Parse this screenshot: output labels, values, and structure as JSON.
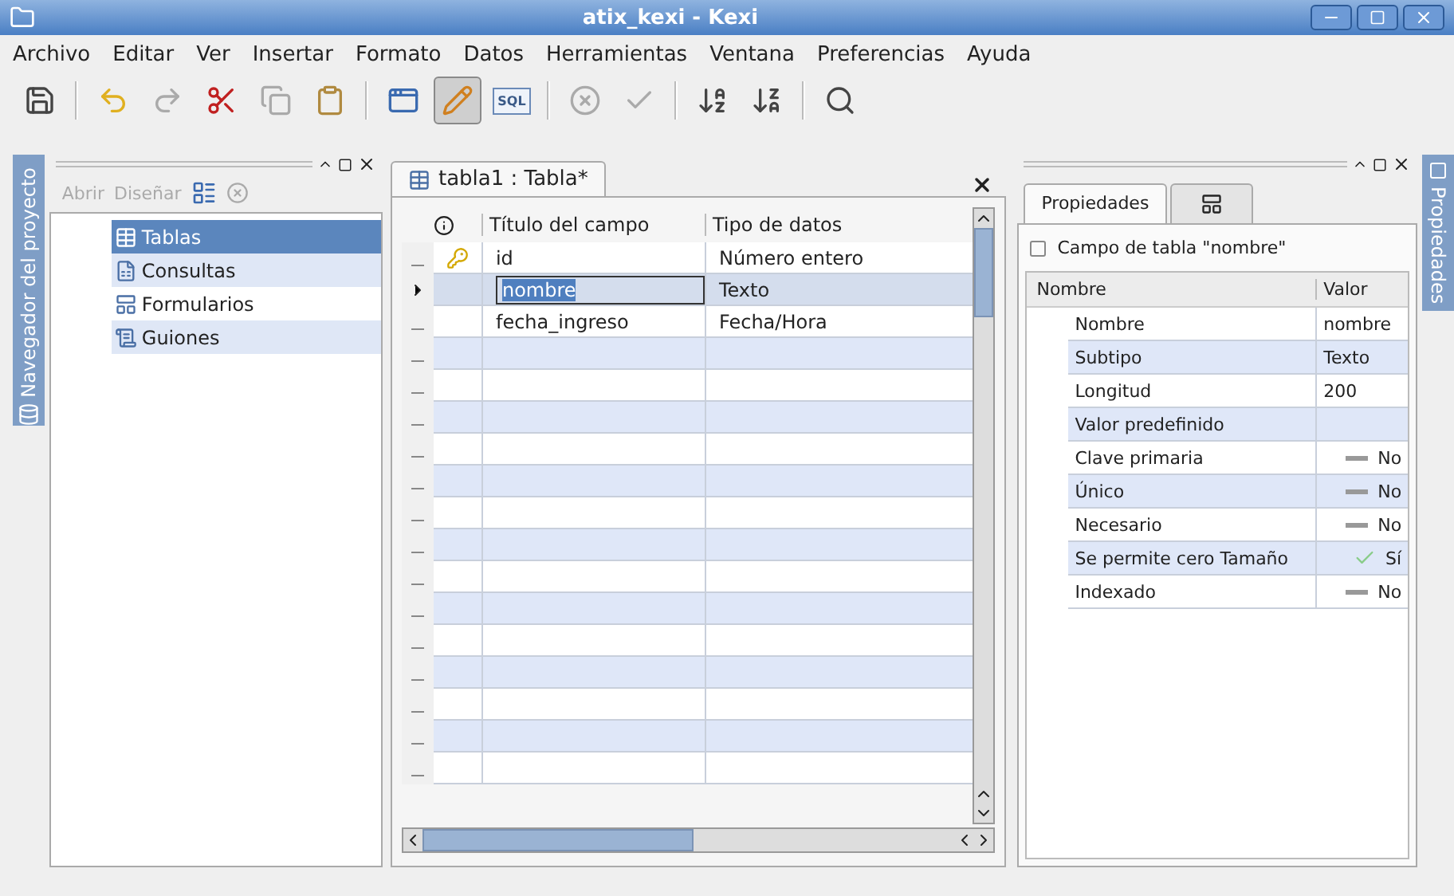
{
  "window": {
    "title": "atix_kexi - Kexi"
  },
  "menu": [
    {
      "label": "Archivo"
    },
    {
      "label": "Editar"
    },
    {
      "label": "Ver"
    },
    {
      "label": "Insertar"
    },
    {
      "label": "Formato"
    },
    {
      "label": "Datos"
    },
    {
      "label": "Herramientas"
    },
    {
      "label": "Ventana"
    },
    {
      "label": "Preferencias"
    },
    {
      "label": "Ayuda"
    }
  ],
  "toolbar": [
    {
      "kind": "save",
      "disabled": false,
      "selected": false
    },
    {
      "kind": "sep"
    },
    {
      "kind": "undo",
      "disabled": false,
      "selected": false
    },
    {
      "kind": "redo",
      "disabled": true,
      "selected": false
    },
    {
      "kind": "cut",
      "disabled": false,
      "selected": false
    },
    {
      "kind": "copy",
      "disabled": true,
      "selected": false
    },
    {
      "kind": "paste",
      "disabled": false,
      "selected": false
    },
    {
      "kind": "sep"
    },
    {
      "kind": "dataview",
      "disabled": false,
      "selected": false
    },
    {
      "kind": "design",
      "disabled": false,
      "selected": true
    },
    {
      "kind": "sql",
      "label": "SQL",
      "disabled": false,
      "selected": false
    },
    {
      "kind": "sep"
    },
    {
      "kind": "cancel",
      "disabled": true,
      "selected": false
    },
    {
      "kind": "accept",
      "disabled": true,
      "selected": false
    },
    {
      "kind": "sep"
    },
    {
      "kind": "sortaz",
      "disabled": false,
      "selected": false
    },
    {
      "kind": "sortza",
      "disabled": false,
      "selected": false
    },
    {
      "kind": "sep"
    },
    {
      "kind": "find",
      "disabled": false,
      "selected": false
    }
  ],
  "navigator": {
    "side_tab": "Navegador del proyecto",
    "actions": [
      {
        "label": "Abrir",
        "disabled": true
      },
      {
        "label": "Diseñar",
        "disabled": true
      }
    ],
    "items": [
      {
        "label": "Tablas",
        "kind": "table",
        "selected": true
      },
      {
        "label": "Consultas",
        "kind": "query",
        "selected": false
      },
      {
        "label": "Formularios",
        "kind": "form",
        "selected": false
      },
      {
        "label": "Guiones",
        "kind": "script",
        "selected": false
      }
    ]
  },
  "document": {
    "tab": "tabla1 : Tabla*",
    "columns": [
      "Título del campo",
      "Tipo de datos"
    ],
    "rows": [
      {
        "field": "id",
        "type": "Número entero",
        "primary_key": true,
        "selected": false
      },
      {
        "field": "nombre",
        "type": "Texto",
        "primary_key": false,
        "selected": true
      },
      {
        "field": "fecha_ingreso",
        "type": "Fecha/Hora",
        "primary_key": false,
        "selected": false
      }
    ]
  },
  "properties": {
    "side_tab": "Propiedades",
    "tabs": [
      {
        "label": "Propiedades",
        "selected": true
      },
      {
        "kind": "icon",
        "selected": false
      }
    ],
    "caption": "Campo de tabla \"nombre\"",
    "columns": [
      "Nombre",
      "Valor"
    ],
    "rows": [
      {
        "name": "Nombre",
        "value": "nombre",
        "kind": "text"
      },
      {
        "name": "Subtipo",
        "value": "Texto",
        "kind": "text"
      },
      {
        "name": "Longitud",
        "value": "200",
        "kind": "text"
      },
      {
        "name": "Valor predefinido",
        "kind": "text"
      },
      {
        "name": "Clave primaria",
        "value": "No",
        "kind": "bool",
        "checked": false
      },
      {
        "name": "Único",
        "value": "No",
        "kind": "bool",
        "checked": false
      },
      {
        "name": "Necesario",
        "value": "No",
        "kind": "bool",
        "checked": false
      },
      {
        "name": "Se permite cero Tamaño",
        "value": "Sí",
        "kind": "bool",
        "checked": true
      },
      {
        "name": "Indexado",
        "value": "No",
        "kind": "bool",
        "checked": false
      }
    ]
  }
}
